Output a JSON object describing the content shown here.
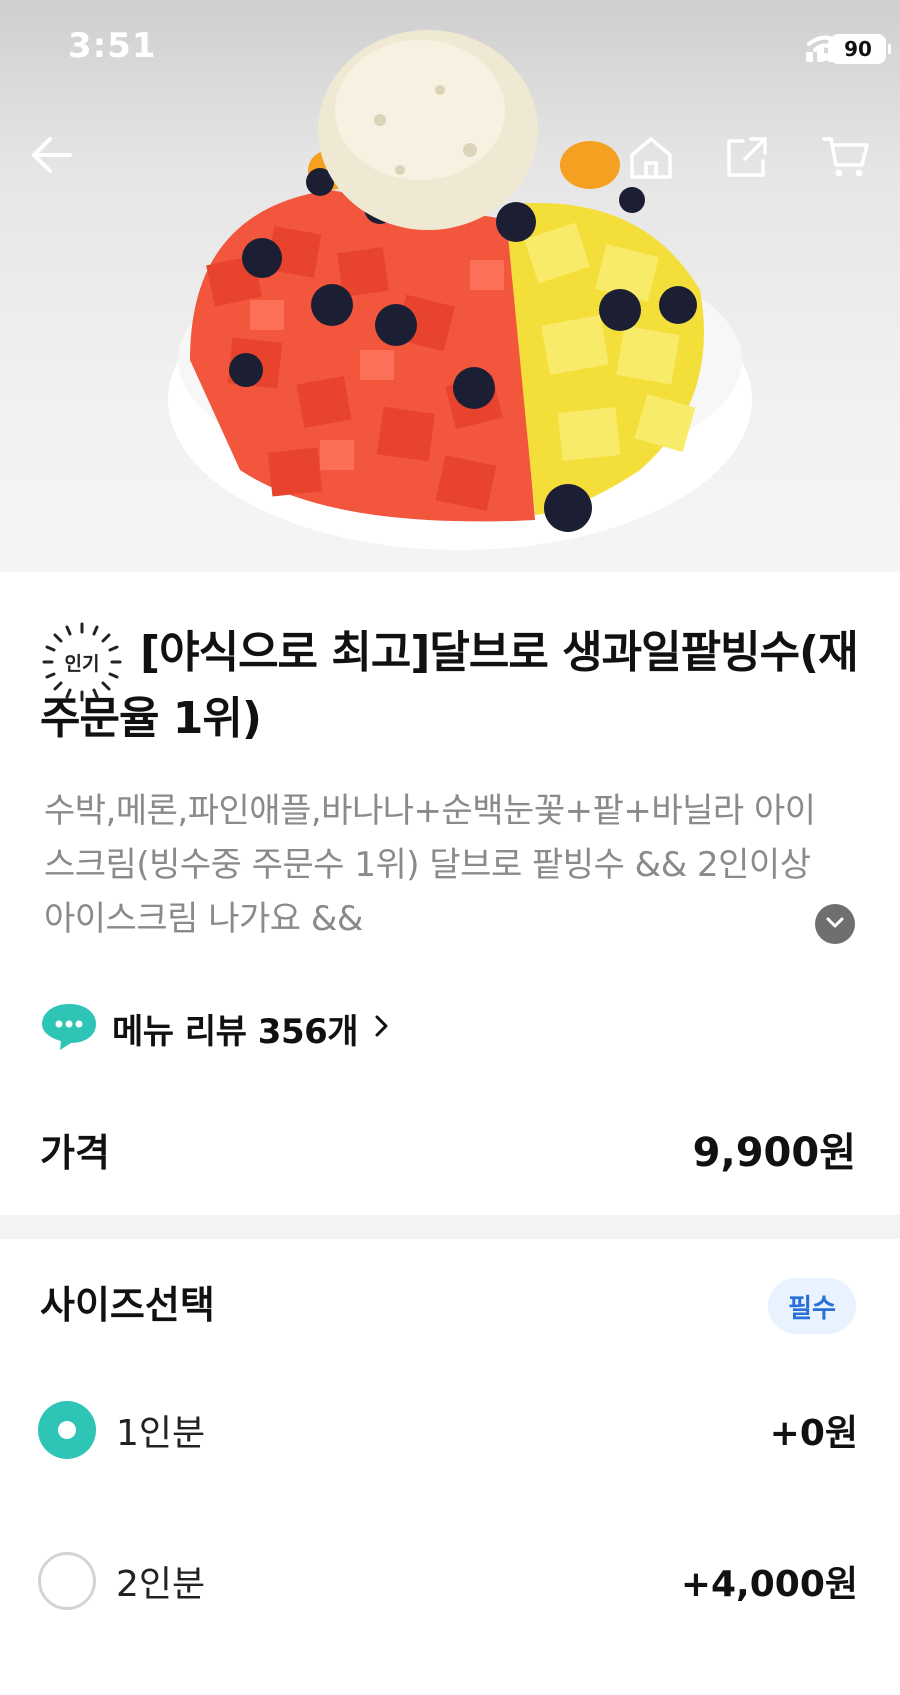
{
  "status_bar": {
    "time": "3:51",
    "battery": "90"
  },
  "product": {
    "badge": "인기",
    "title": "[야식으로 최고]달브로 생과일팥빙수(재주문율  1위)",
    "description": "수박,메론,파인애플,바나나+순백눈꽃+팥+바닐라 아이스크림(빙수중 주문수 1위) 달브로 팥빙수 && 2인이상 아이스크림 나가요 &&",
    "review_link": "메뉴 리뷰 356개",
    "price_label": "가격",
    "price": "9,900원"
  },
  "size_section": {
    "title": "사이즈선택",
    "required": "필수",
    "options": [
      {
        "label": "1인분",
        "price": "+0원",
        "selected": true
      },
      {
        "label": "2인분",
        "price": "+4,000원",
        "selected": false
      }
    ]
  },
  "icons": [
    "back-arrow-icon",
    "home-icon",
    "share-icon",
    "cart-icon",
    "chevron-down-icon",
    "chevron-right-icon",
    "speech-bubble-icon",
    "signal-icon",
    "wifi-icon",
    "battery-icon"
  ],
  "colors": {
    "accent": "#2ec4b6",
    "required_bg": "#e8f3ff",
    "required_text": "#2a6fd6",
    "muted_text": "#8a8a8a"
  }
}
